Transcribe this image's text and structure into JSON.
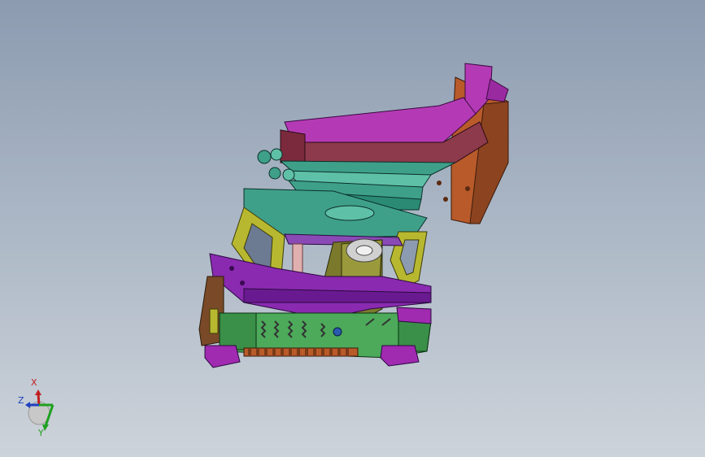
{
  "viewport": {
    "background_top": "#8c9bb0",
    "background_bottom": "#cdd3da"
  },
  "colors": {
    "magenta": "#b43ab5",
    "maroon": "#8c3a4c",
    "teal": "#3fa08a",
    "yellow_olive": "#b8b830",
    "green": "#4caa5a",
    "brown_orange": "#b85a2a",
    "purple": "#7a3ca0",
    "olive_dark": "#7b7a2c"
  },
  "triad": {
    "x_label": "X",
    "y_label": "Y",
    "z_label": "Z",
    "x_color": "#c02020",
    "y_color": "#20a020",
    "z_color": "#2040c0"
  }
}
